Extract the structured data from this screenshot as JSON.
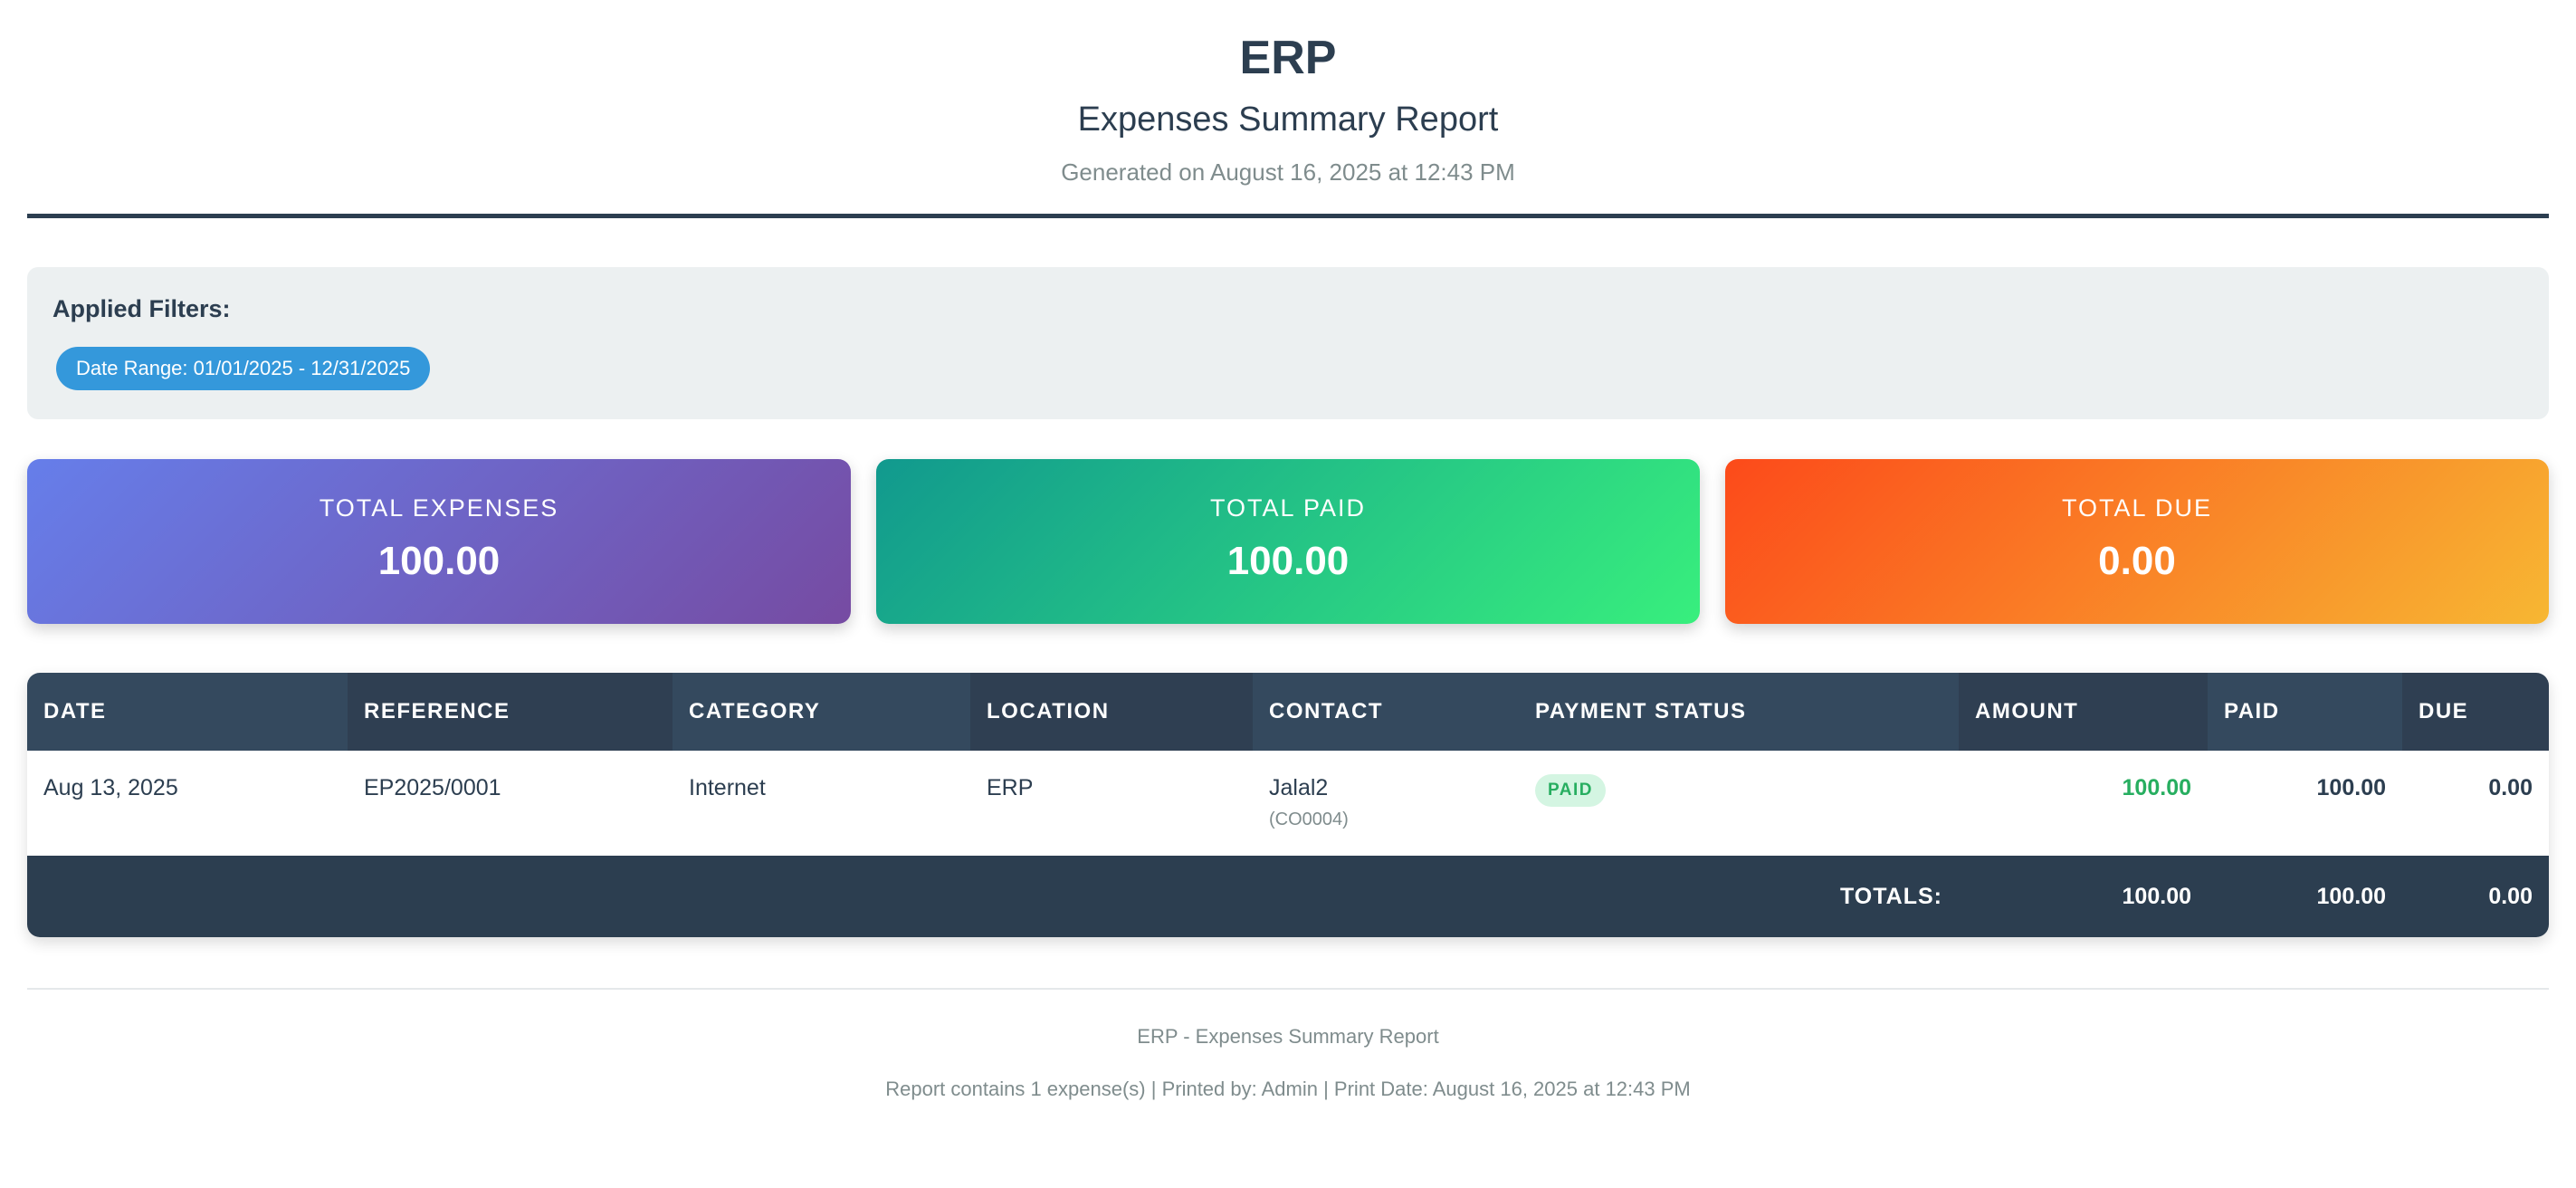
{
  "header": {
    "title": "ERP",
    "subtitle": "Expenses Summary Report",
    "generated": "Generated on August 16, 2025 at 12:43 PM"
  },
  "filters": {
    "label": "Applied Filters:",
    "chips": [
      "Date Range: 01/01/2025 - 12/31/2025"
    ]
  },
  "summary": {
    "cards": [
      {
        "label": "TOTAL EXPENSES",
        "value": "100.00",
        "gradient": [
          "#667eea",
          "#764ba2"
        ]
      },
      {
        "label": "TOTAL PAID",
        "value": "100.00",
        "gradient": [
          "#11998e",
          "#38ef7d"
        ]
      },
      {
        "label": "TOTAL DUE",
        "value": "0.00",
        "gradient": [
          "#fc4a1a",
          "#f7b733"
        ]
      }
    ]
  },
  "table": {
    "columns": [
      "DATE",
      "REFERENCE",
      "CATEGORY",
      "LOCATION",
      "CONTACT",
      "PAYMENT STATUS",
      "AMOUNT",
      "PAID",
      "DUE"
    ],
    "rows": [
      {
        "date": "Aug 13, 2025",
        "reference": "EP2025/0001",
        "category": "Internet",
        "location": "ERP",
        "contact": "Jalal2",
        "contact_code": "(CO0004)",
        "status": "PAID",
        "amount": "100.00",
        "paid": "100.00",
        "due": "0.00"
      }
    ],
    "totals": {
      "label": "TOTALS:",
      "amount": "100.00",
      "paid": "100.00",
      "due": "0.00"
    }
  },
  "footer": {
    "line1": "ERP - Expenses Summary Report",
    "line2": "Report contains 1 expense(s) | Printed by: Admin | Print Date: August 16, 2025 at 12:43 PM"
  },
  "colors": {
    "header_dark": "#2c3e50",
    "chip_blue": "#3498db",
    "paid_green": "#27ae60"
  }
}
